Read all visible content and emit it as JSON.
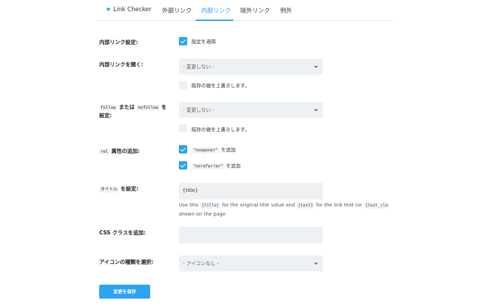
{
  "tabs": [
    {
      "label": "Link Checker",
      "active": false
    },
    {
      "label": "外部リンク",
      "active": false
    },
    {
      "label": "内部リンク",
      "active": true
    },
    {
      "label": "除外リンク",
      "active": false
    },
    {
      "label": "例外",
      "active": false
    }
  ],
  "accent_color": "#2ea3f2",
  "settings": {
    "apply": {
      "label": "内部リンク設定:",
      "checkbox_label": "設定を適用",
      "checked": true
    },
    "open": {
      "label": "内部リンクを開く:",
      "select_value": "- 変更しない -",
      "overwrite_label": "既存の値を上書きします。",
      "overwrite_checked": false
    },
    "follow": {
      "code1": "follow",
      "text1": " または ",
      "code2": "nofollow",
      "text2": " を",
      "label_line2": "設定:",
      "select_value": "- 変更しない -",
      "overwrite_label": "既存の値を上書きします。",
      "overwrite_checked": false
    },
    "rel": {
      "code": "rel",
      "label_suffix": " 属性の追加:",
      "opt1_code": "\"noopener\"",
      "opt1_suffix": " を追加",
      "opt1_checked": true,
      "opt2_code": "\"noreferrer\"",
      "opt2_suffix": " を追加",
      "opt2_checked": true
    },
    "title": {
      "prefix": "タイトル",
      "suffix": " を設定:",
      "value": "{title}",
      "help_1": "Use this ",
      "help_code1": "{title}",
      "help_2": " for the original title value and ",
      "help_code2": "{text}",
      "help_3": " for the link text (or ",
      "help_code3": "{text_cle",
      "help_line2": "shown on the page"
    },
    "css": {
      "label": "CSS クラスを追加:",
      "value": ""
    },
    "icon": {
      "label": "アイコンの種類を選択:",
      "select_value": "- アイコンなし -"
    }
  },
  "save_label": "変更を保存"
}
